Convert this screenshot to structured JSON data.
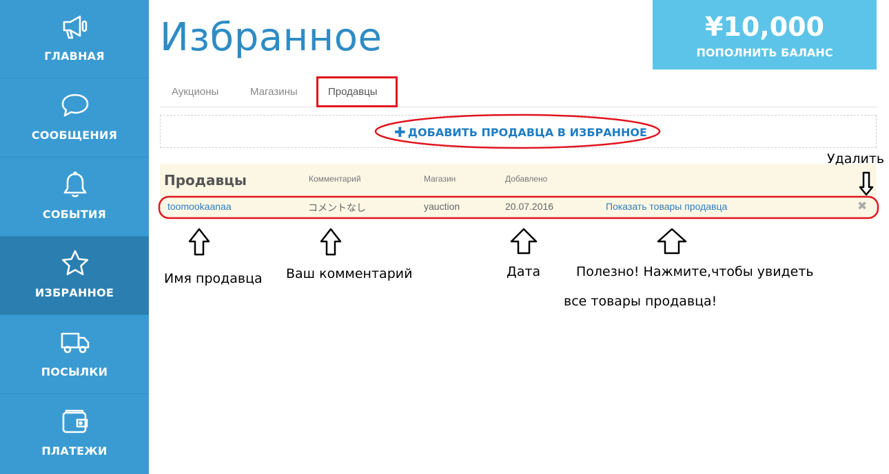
{
  "sidebar": {
    "items": [
      {
        "label": "ГЛАВНАЯ",
        "icon": "megaphone-icon"
      },
      {
        "label": "СООБЩЕНИЯ",
        "icon": "chat-bubble-icon"
      },
      {
        "label": "СОБЫТИЯ",
        "icon": "bell-icon"
      },
      {
        "label": "ИЗБРАННОЕ",
        "icon": "star-icon",
        "active": true
      },
      {
        "label": "ПОСЫЛКИ",
        "icon": "truck-icon"
      },
      {
        "label": "ПЛАТЕЖИ",
        "icon": "wallet-icon"
      }
    ]
  },
  "header": {
    "title": "Избранное",
    "balance": {
      "amount": "¥10,000",
      "label": "ПОПОЛНИТЬ БАЛАНС"
    }
  },
  "tabs": [
    {
      "label": "Аукционы"
    },
    {
      "label": "Магазины"
    },
    {
      "label": "Продавцы",
      "active": true
    }
  ],
  "add_seller": {
    "label": "ДОБАВИТЬ ПРОДАВЦА В ИЗБРАННОЕ",
    "icon": "plus-icon"
  },
  "table": {
    "title": "Продавцы",
    "columns": [
      "Комментарий",
      "Магазин",
      "Добавлено"
    ],
    "rows": [
      {
        "seller": "toomookaanaa",
        "comment": "コメントなし",
        "shop": "yauction",
        "added": "20.07.2016",
        "action": "Показать товары продавца"
      }
    ]
  },
  "annotations": {
    "delete": "Удалить",
    "seller_name": "Имя продавца",
    "comment": "Ваш комментарий",
    "date": "Дата",
    "useful_line1": "Полезно! Нажмите,чтобы увидеть",
    "useful_line2": "все товары продавца!"
  },
  "colors": {
    "sidebar": "#3a9bd2",
    "sidebar_active": "#2a7fb0",
    "balance": "#5cc4e8",
    "title": "#2e8cc5",
    "link": "#2e7dbf",
    "highlight": "#e0141e",
    "row": "#fbf7e4"
  }
}
